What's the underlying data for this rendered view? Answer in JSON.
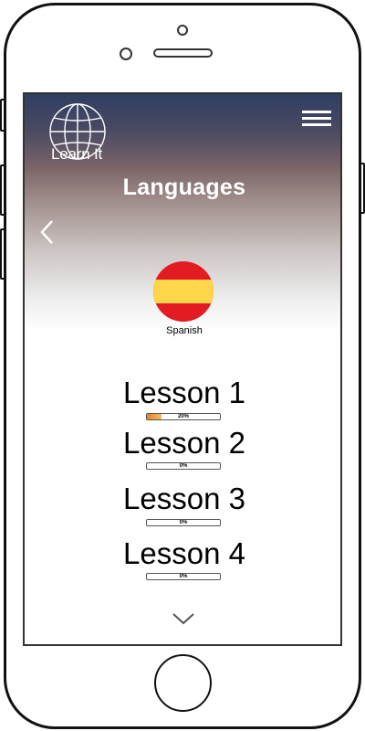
{
  "app": {
    "logo_text": "Learn It",
    "logo_icon": "globe-icon",
    "menu_icon": "hamburger-menu-icon"
  },
  "page": {
    "title": "Languages",
    "back_icon": "chevron-left-icon",
    "scroll_icon": "chevron-down-icon"
  },
  "language": {
    "name": "Spanish",
    "flag_icon": "spain-flag-icon",
    "flag_colors": {
      "red": "#e31b23",
      "yellow": "#ffd54a"
    }
  },
  "lessons": [
    {
      "title": "Lesson 1",
      "progress_label": "20%",
      "progress": 0.2
    },
    {
      "title": "Lesson 2",
      "progress_label": "0%",
      "progress": 0
    },
    {
      "title": "Lesson 3",
      "progress_label": "0%",
      "progress": 0
    },
    {
      "title": "Lesson 4",
      "progress_label": "0%",
      "progress": 0
    }
  ],
  "colors": {
    "header_top": "#2f3e62",
    "progress_fill": "#e08a1e"
  }
}
